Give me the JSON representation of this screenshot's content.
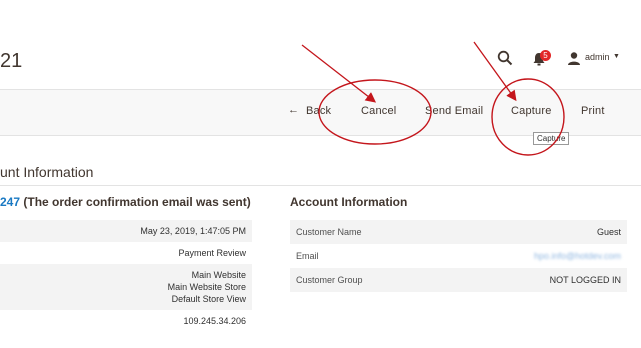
{
  "header": {
    "page_title": "21",
    "admin_label": "admin",
    "notification_count": "5"
  },
  "toolbar": {
    "back_label": "Back",
    "cancel_label": "Cancel",
    "send_email_label": "Send Email",
    "capture_label": "Capture",
    "print_label": "Print",
    "tooltip": "Capture"
  },
  "section": {
    "title": "unt Information"
  },
  "order": {
    "heading_link": "247",
    "heading_rest": " (The order confirmation email was sent)",
    "rows": [
      {
        "value": "May 23, 2019, 1:47:05 PM"
      },
      {
        "value": "Payment Review"
      },
      {
        "value_lines": [
          "Main Website",
          "Main Website Store",
          "Default Store View"
        ]
      },
      {
        "value": "109.245.34.206"
      }
    ]
  },
  "account": {
    "title": "Account Information",
    "rows": [
      {
        "label": "Customer Name",
        "value": "Guest"
      },
      {
        "label": "Email",
        "value": "hpo.info@hotdev.com"
      },
      {
        "label": "Customer Group",
        "value": "NOT LOGGED IN"
      }
    ]
  },
  "colors": {
    "annotation": "#c4161c",
    "link": "#1979c3"
  }
}
